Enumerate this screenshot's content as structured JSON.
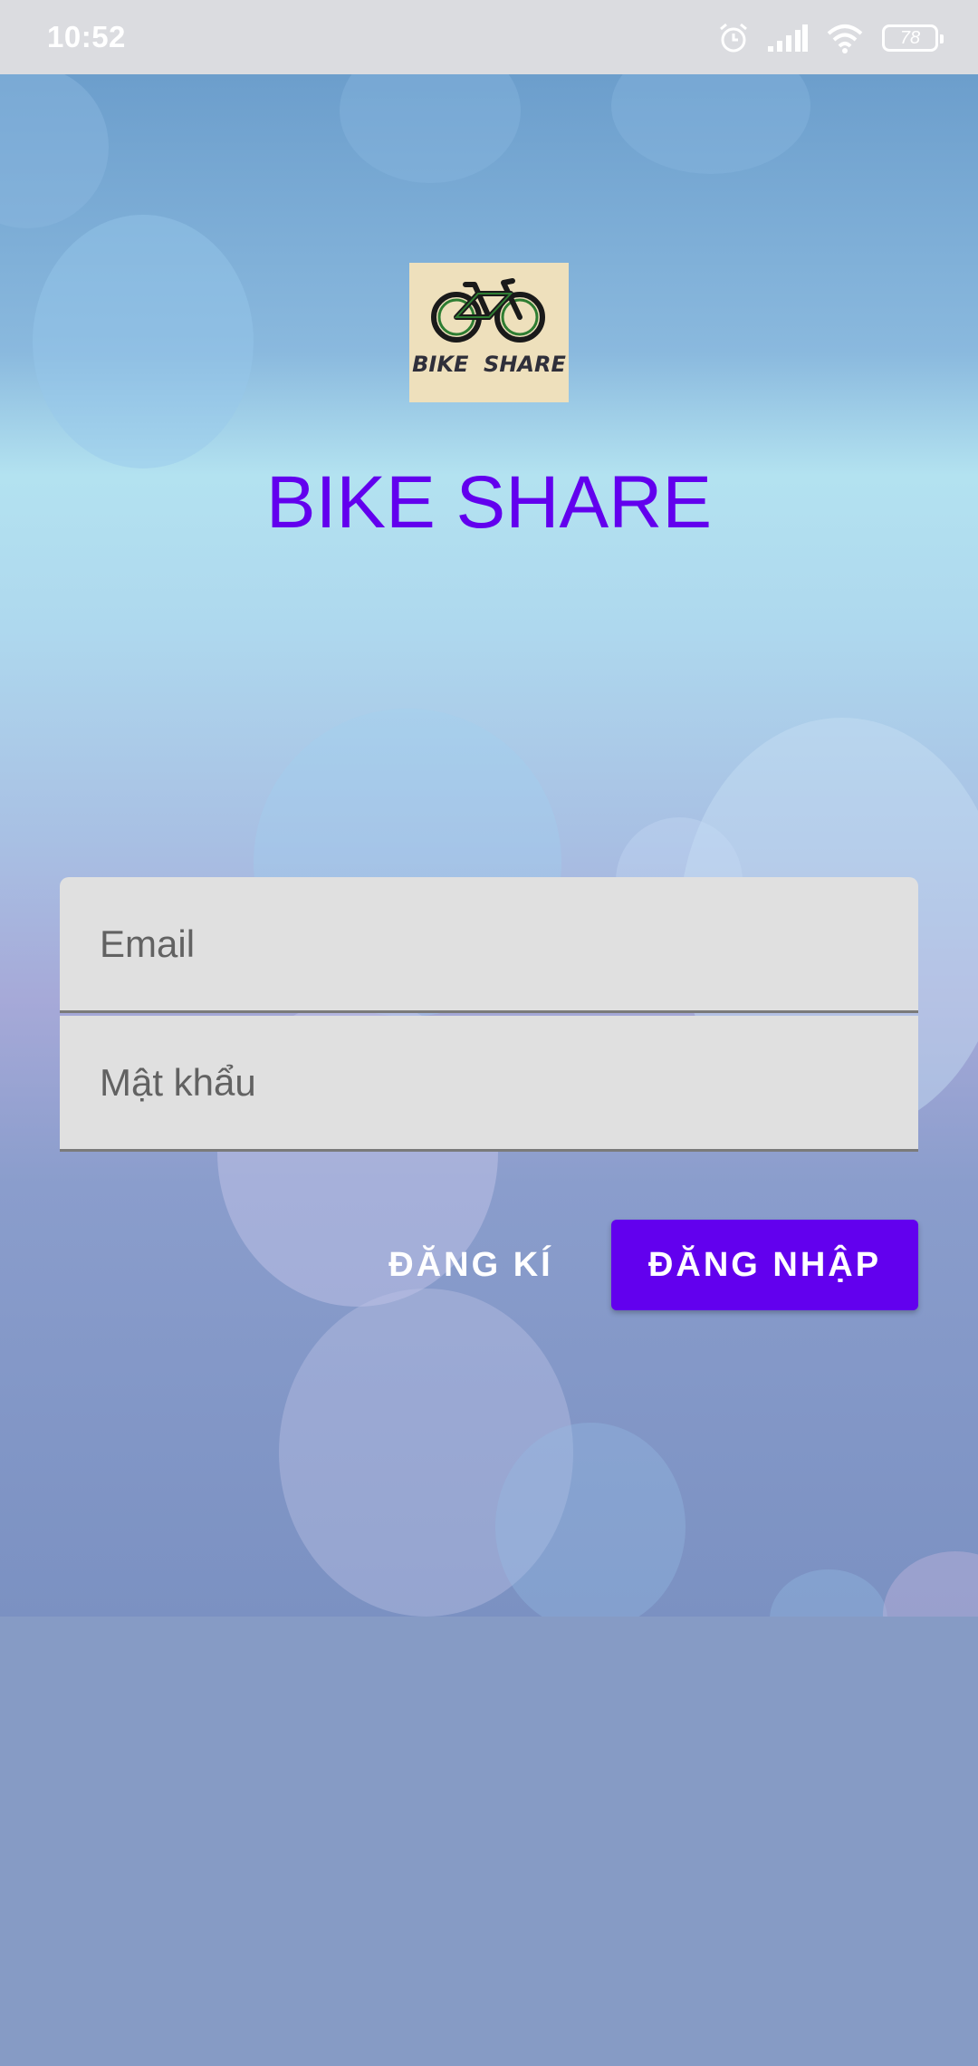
{
  "status_bar": {
    "time": "10:52",
    "battery_level": "78",
    "icons": [
      "alarm-icon",
      "signal-icon",
      "wifi-icon",
      "battery-icon"
    ]
  },
  "logo": {
    "text": "BIKE  SHARE",
    "icon": "bicycle-icon"
  },
  "app_title": "BIKE SHARE",
  "form": {
    "email_placeholder": "Email",
    "email_value": "",
    "password_placeholder": "Mật khẩu",
    "password_value": ""
  },
  "buttons": {
    "register_label": "ĐĂNG KÍ",
    "login_label": "ĐĂNG NHẬP"
  },
  "colors": {
    "accent": "#6200ee",
    "field_bg": "#e0e0e0",
    "status_bar_bg": "#dbdce0",
    "bottom_bg": "#869bc5"
  }
}
